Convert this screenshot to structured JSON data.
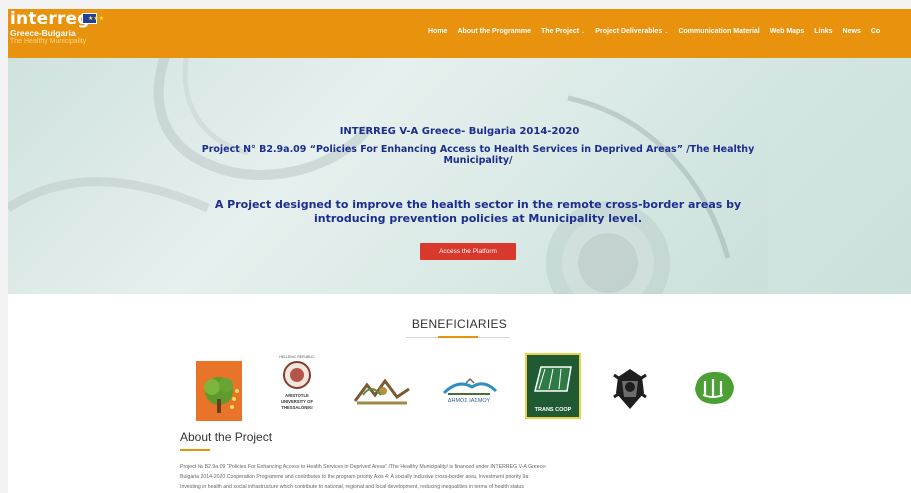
{
  "brand": {
    "name": "interreg",
    "sub_program": "Greece-Bulgaria",
    "sub_project": "The Healthy Municipality",
    "flag_stars": "★★★",
    "colors": {
      "header": "#e8920e",
      "accent": "#e8920e",
      "hero_text": "#1c2d8f",
      "button": "#d9382c"
    }
  },
  "nav": {
    "items": [
      {
        "label": "Home",
        "dropdown": false
      },
      {
        "label": "About the Programme",
        "dropdown": false
      },
      {
        "label": "The Project",
        "dropdown": true
      },
      {
        "label": "Project Deliverables",
        "dropdown": true
      },
      {
        "label": "Communication Material",
        "dropdown": false
      },
      {
        "label": "Web Maps",
        "dropdown": false
      },
      {
        "label": "Links",
        "dropdown": false
      },
      {
        "label": "News",
        "dropdown": false
      },
      {
        "label": "Co",
        "dropdown": false
      }
    ],
    "dropdown_glyph": "⌄"
  },
  "hero": {
    "line1": "INTERREG V-A Greece- Bulgaria 2014-2020",
    "line2": "Project N° B2.9a.09 “Policies For Enhancing Access to Health Services in Deprived Areas” /The Healthy Municipality/",
    "line3": "A Project designed to improve the health sector in the remote cross-border areas by introducing prevention policies at Municipality level.",
    "button_label": "Access the Platform"
  },
  "beneficiaries": {
    "title": "BENEFICIARIES",
    "logos": [
      {
        "name": "tree-logo"
      },
      {
        "name": "aristotle-university-logo",
        "lines": [
          "HELLENIC REPUBLIC",
          "ARISTOTLE",
          "UNIVERSITY OF",
          "THESSALONIKI"
        ]
      },
      {
        "name": "rhodope-logo"
      },
      {
        "name": "dimos-iasmou-logo",
        "text": "ΔΗΜΟΣ ΙΑΣΜΟΥ"
      },
      {
        "name": "trans-coop-logo",
        "text": "TRANS COOP"
      },
      {
        "name": "lion-crest-logo"
      },
      {
        "name": "green-leaf-logo"
      }
    ]
  },
  "about": {
    "title": "About the Project",
    "text_line1": "Project № B2.9a.09 “Policies For Enhancing Access to Health Services in Deprived Areas” /The Healthy Municipality/ is financed under INTERREG V-A Greece-",
    "text_line2": "Bulgaria 2014-2020 Cooperation Programme and contributes to the program priority Axis 4: A socially inclusive cross-border area, Investment priority 9a:",
    "text_line3": "Investing in health and social infrastructure which contribute to national, regional and local development, reducing inequalities in terms of health status"
  }
}
